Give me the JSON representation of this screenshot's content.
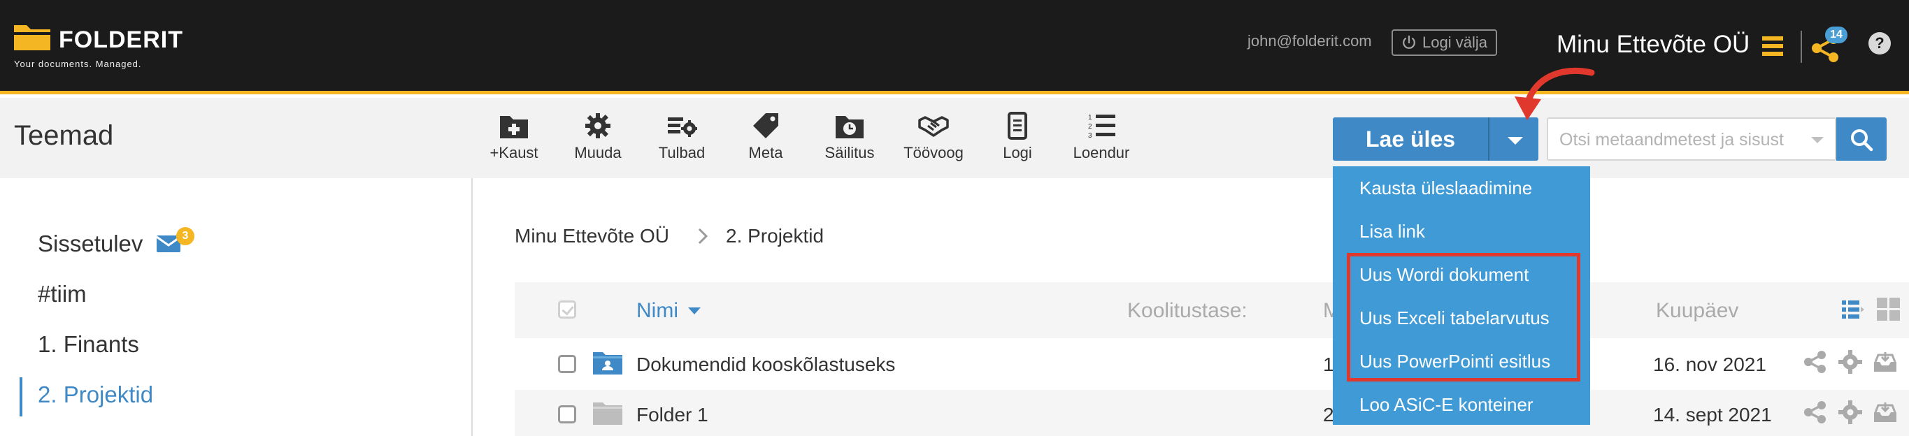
{
  "brand": {
    "name": "FOLDERIT",
    "tagline": "Your documents. Managed."
  },
  "header": {
    "email": "john@folderit.com",
    "logout_label": "Logi välja",
    "company": "Minu Ettevõte OÜ",
    "share_count": "14",
    "help_label": "?"
  },
  "page": {
    "title": "Teemad"
  },
  "toolbar": {
    "tools": [
      {
        "label": "+Kaust",
        "icon": "folder-plus-icon"
      },
      {
        "label": "Muuda",
        "icon": "gear-icon"
      },
      {
        "label": "Tulbad",
        "icon": "columns-settings-icon"
      },
      {
        "label": "Meta",
        "icon": "tag-icon"
      },
      {
        "label": "Säilitus",
        "icon": "folder-clock-icon"
      },
      {
        "label": "Töövoog",
        "icon": "handshake-icon"
      },
      {
        "label": "Logi",
        "icon": "document-log-icon"
      },
      {
        "label": "Loendur",
        "icon": "numbered-list-icon"
      }
    ],
    "upload_label": "Lae üles",
    "search_placeholder": "Otsi metaandmetest ja sisust"
  },
  "upload_menu": {
    "items": [
      "Kausta üleslaadimine",
      "Lisa link",
      "Uus Wordi dokument",
      "Uus Exceli tabelarvutus",
      "Uus PowerPointi esitlus",
      "Loo ASiC-E konteiner"
    ]
  },
  "sidebar": {
    "items": [
      {
        "label": "Sissetulev",
        "badge": "3"
      },
      {
        "label": "#tiim"
      },
      {
        "label": "1. Finants"
      },
      {
        "label": "2. Projektid"
      }
    ]
  },
  "breadcrumb": [
    "Minu Ettevõte OÜ",
    "2. Projektid"
  ],
  "list": {
    "columns": {
      "name": "Nimi",
      "level": "Koolitustase:",
      "m": "M",
      "date": "Kuupäev"
    },
    "rows": [
      {
        "name": "Dokumendid kooskõlastuseks",
        "mid": "1(",
        "date": "16. nov 2021"
      },
      {
        "name": "Folder 1",
        "mid": "2",
        "date": "14. sept 2021"
      }
    ]
  },
  "colors": {
    "accent": "#3f89c6",
    "brand_yellow": "#f5b623",
    "highlight_red": "#e0382c",
    "topbar": "#1b1b1b"
  }
}
